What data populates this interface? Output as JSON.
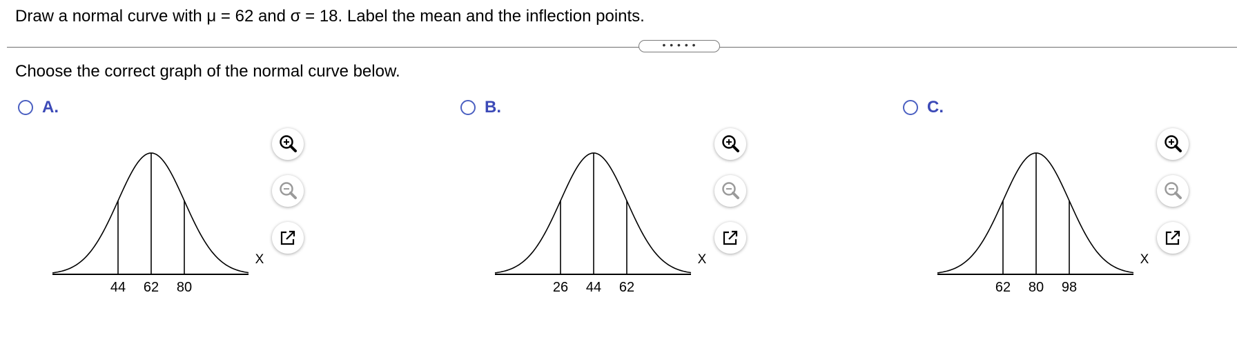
{
  "question": "Draw a normal curve with μ = 62 and σ = 18. Label the mean and the inflection points.",
  "expand_button": "• • • • •",
  "prompt": "Choose the correct graph of the normal curve below.",
  "options": [
    {
      "letter": "A.",
      "axis_label": "X",
      "ticks": [
        "44",
        "62",
        "80"
      ]
    },
    {
      "letter": "B.",
      "axis_label": "X",
      "ticks": [
        "26",
        "44",
        "62"
      ]
    },
    {
      "letter": "C.",
      "axis_label": "X",
      "ticks": [
        "62",
        "80",
        "98"
      ]
    }
  ],
  "tools": [
    "zoom-in-icon",
    "zoom-out-icon",
    "popout-icon"
  ],
  "colors": {
    "option_letter": "#3c4ab7",
    "radio_border": "#4a5fc1",
    "divider": "#6d6d6d"
  }
}
